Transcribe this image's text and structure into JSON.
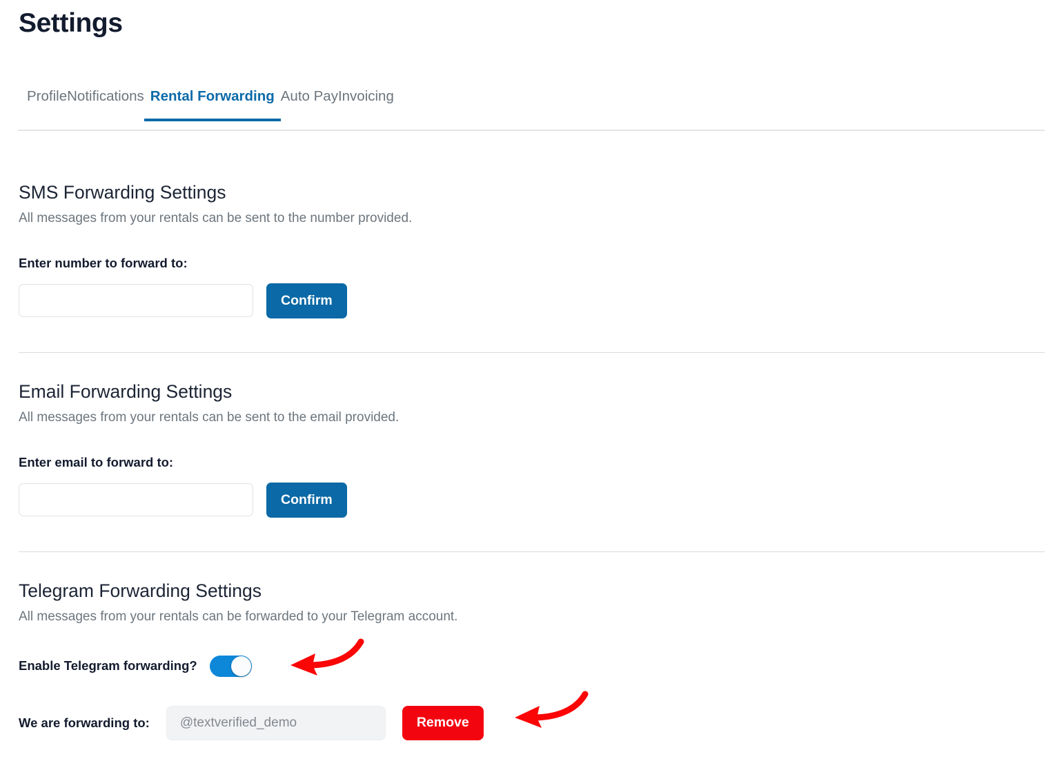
{
  "header": {
    "title": "Settings"
  },
  "tabs": [
    {
      "label": "Profile",
      "active": false
    },
    {
      "label": "Notifications",
      "active": false
    },
    {
      "label": "Rental Forwarding",
      "active": true
    },
    {
      "label": "Auto Pay",
      "active": false
    },
    {
      "label": "Invoicing",
      "active": false
    }
  ],
  "sms_section": {
    "heading": "SMS Forwarding Settings",
    "description": "All messages from your rentals can be sent to the number provided.",
    "field_label": "Enter number to forward to:",
    "input_value": "",
    "input_placeholder": "",
    "confirm_label": "Confirm"
  },
  "email_section": {
    "heading": "Email Forwarding Settings",
    "description": "All messages from your rentals can be sent to the email provided.",
    "field_label": "Enter email to forward to:",
    "input_value": "",
    "input_placeholder": "",
    "confirm_label": "Confirm"
  },
  "telegram_section": {
    "heading": "Telegram Forwarding Settings",
    "description": "All messages from your rentals can be forwarded to your Telegram account.",
    "toggle_label": "Enable Telegram forwarding?",
    "toggle_state": "on",
    "forwarding_label": "We are forwarding to:",
    "forwarding_value": "@textverified_demo",
    "remove_label": "Remove"
  },
  "colors": {
    "accent_blue": "#0b6aa8",
    "toggle_blue": "#0d87d8",
    "danger_red": "#f3050f",
    "title_navy": "#131b2e",
    "muted_gray": "#6c757d",
    "annotation_red": "#fb0606"
  },
  "annotations": [
    {
      "name": "arrow-to-toggle",
      "points_to": "Enable Telegram forwarding toggle"
    },
    {
      "name": "arrow-to-remove",
      "points_to": "Remove button"
    }
  ]
}
